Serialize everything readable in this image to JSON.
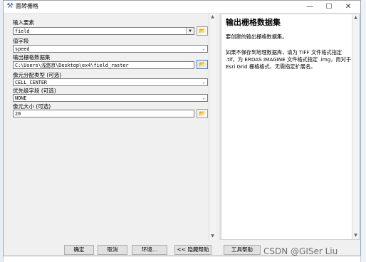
{
  "window": {
    "title": "面转栅格",
    "minimize_glyph": "—",
    "maximize_glyph": "☐",
    "close_glyph": "✕"
  },
  "form": {
    "input_features": {
      "label": "输入要素",
      "value": "field"
    },
    "value_field": {
      "label": "值字段",
      "value": "speed"
    },
    "output_raster": {
      "label": "输出栅格数据集",
      "value": "C:\\Users\\浅悠京\\Desktop\\ex4\\field_raster"
    },
    "cell_assignment": {
      "label": "像元分配类型 (可选)",
      "value": "CELL_CENTER"
    },
    "priority_field": {
      "label": "优先级字段 (可选)",
      "value": "NONE"
    },
    "cellsize": {
      "label": "像元大小 (可选)",
      "value": "20"
    }
  },
  "help": {
    "title": "输出栅格数据集",
    "paragraph1": "要创建的输出栅格数据集。",
    "paragraph2": "如果不保存到地理数据库，请为 TIFF 文件格式指定 .tif，为 ERDAS IMAGINE 文件格式指定 .img，而对于 Esri Grid 栅格格式，无需指定扩展名。"
  },
  "buttons": {
    "ok": "确定",
    "cancel": "取消",
    "environments": "环境...",
    "hide_help": "<< 隐藏帮助",
    "tool_help": "工具帮助"
  },
  "watermark": "CSDN @GISer Liu",
  "icons": {
    "title_tool": "hammer-icon",
    "browse": "folder-icon"
  }
}
